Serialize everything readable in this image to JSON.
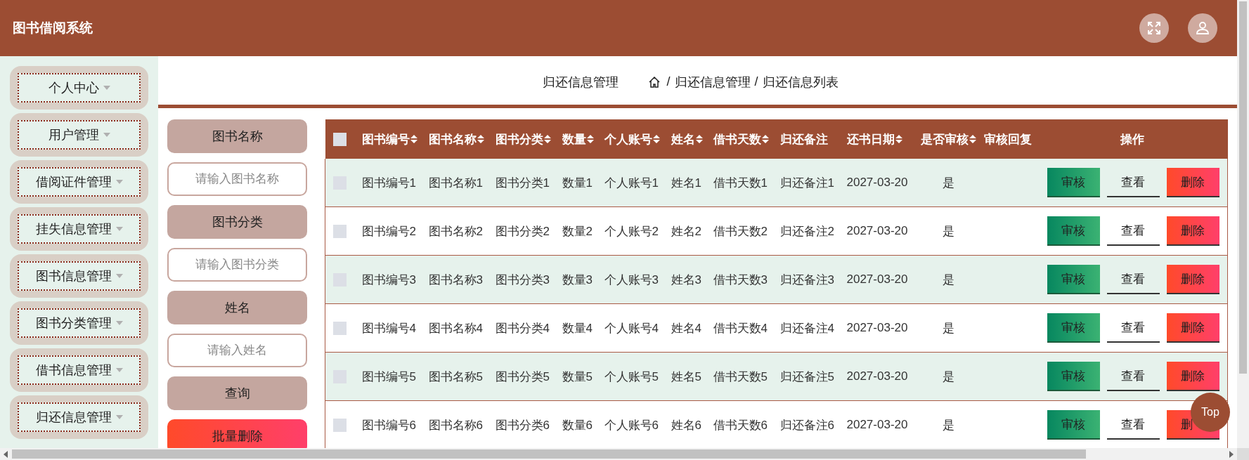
{
  "header": {
    "title": "图书借阅系统"
  },
  "sidebar": {
    "items": [
      {
        "label": "个人中心"
      },
      {
        "label": "用户管理"
      },
      {
        "label": "借阅证件管理"
      },
      {
        "label": "挂失信息管理"
      },
      {
        "label": "图书信息管理"
      },
      {
        "label": "图书分类管理"
      },
      {
        "label": "借书信息管理"
      },
      {
        "label": "归还信息管理"
      }
    ]
  },
  "breadcrumb": {
    "page_title": "归还信息管理",
    "separator": "/",
    "trail": [
      "归还信息管理",
      "归还信息列表"
    ]
  },
  "filters": [
    {
      "label": "图书名称",
      "placeholder": "请输入图书名称"
    },
    {
      "label": "图书分类",
      "placeholder": "请输入图书分类"
    },
    {
      "label": "姓名",
      "placeholder": "请输入姓名"
    }
  ],
  "filter_buttons": [
    {
      "label": "查询",
      "kind": "search"
    },
    {
      "label": "批量删除",
      "kind": "danger"
    }
  ],
  "table": {
    "select_all_checked": false,
    "columns": [
      {
        "label": "图书编号",
        "sortable": true
      },
      {
        "label": "图书名称",
        "sortable": true
      },
      {
        "label": "图书分类",
        "sortable": true
      },
      {
        "label": "数量",
        "sortable": true
      },
      {
        "label": "个人账号",
        "sortable": true
      },
      {
        "label": "姓名",
        "sortable": true
      },
      {
        "label": "借书天数",
        "sortable": true
      },
      {
        "label": "归还备注",
        "sortable": false
      },
      {
        "label": "还书日期",
        "sortable": true
      },
      {
        "label": "是否审核",
        "sortable": true
      },
      {
        "label": "审核回复",
        "sortable": false
      },
      {
        "label": "操作",
        "sortable": false
      }
    ],
    "rows": [
      {
        "checked": false,
        "cells": [
          "图书编号1",
          "图书名称1",
          "图书分类1",
          "数量1",
          "个人账号1",
          "姓名1",
          "借书天数1",
          "归还备注1",
          "2027-03-20",
          "是",
          ""
        ],
        "actions": [
          {
            "label": "审核",
            "kind": "review"
          },
          {
            "label": "查看",
            "kind": "view"
          },
          {
            "label": "删除",
            "kind": "delete"
          }
        ]
      },
      {
        "checked": false,
        "cells": [
          "图书编号2",
          "图书名称2",
          "图书分类2",
          "数量2",
          "个人账号2",
          "姓名2",
          "借书天数2",
          "归还备注2",
          "2027-03-20",
          "是",
          ""
        ],
        "actions": [
          {
            "label": "审核",
            "kind": "review"
          },
          {
            "label": "查看",
            "kind": "view"
          },
          {
            "label": "删除",
            "kind": "delete"
          }
        ]
      },
      {
        "checked": false,
        "cells": [
          "图书编号3",
          "图书名称3",
          "图书分类3",
          "数量3",
          "个人账号3",
          "姓名3",
          "借书天数3",
          "归还备注3",
          "2027-03-20",
          "是",
          ""
        ],
        "actions": [
          {
            "label": "审核",
            "kind": "review"
          },
          {
            "label": "查看",
            "kind": "view"
          },
          {
            "label": "删除",
            "kind": "delete"
          }
        ]
      },
      {
        "checked": false,
        "cells": [
          "图书编号4",
          "图书名称4",
          "图书分类4",
          "数量4",
          "个人账号4",
          "姓名4",
          "借书天数4",
          "归还备注4",
          "2027-03-20",
          "是",
          ""
        ],
        "actions": [
          {
            "label": "审核",
            "kind": "review"
          },
          {
            "label": "查看",
            "kind": "view"
          },
          {
            "label": "删除",
            "kind": "delete"
          }
        ]
      },
      {
        "checked": false,
        "cells": [
          "图书编号5",
          "图书名称5",
          "图书分类5",
          "数量5",
          "个人账号5",
          "姓名5",
          "借书天数5",
          "归还备注5",
          "2027-03-20",
          "是",
          ""
        ],
        "actions": [
          {
            "label": "审核",
            "kind": "review"
          },
          {
            "label": "查看",
            "kind": "view"
          },
          {
            "label": "删除",
            "kind": "delete"
          }
        ]
      },
      {
        "checked": false,
        "cells": [
          "图书编号6",
          "图书名称6",
          "图书分类6",
          "数量6",
          "个人账号6",
          "姓名6",
          "借书天数6",
          "归还备注6",
          "2027-03-20",
          "是",
          ""
        ],
        "actions": [
          {
            "label": "审核",
            "kind": "review"
          },
          {
            "label": "查看",
            "kind": "view"
          },
          {
            "label": "删",
            "kind": "delete"
          }
        ]
      }
    ]
  },
  "back_to_top": {
    "label": "Top"
  }
}
